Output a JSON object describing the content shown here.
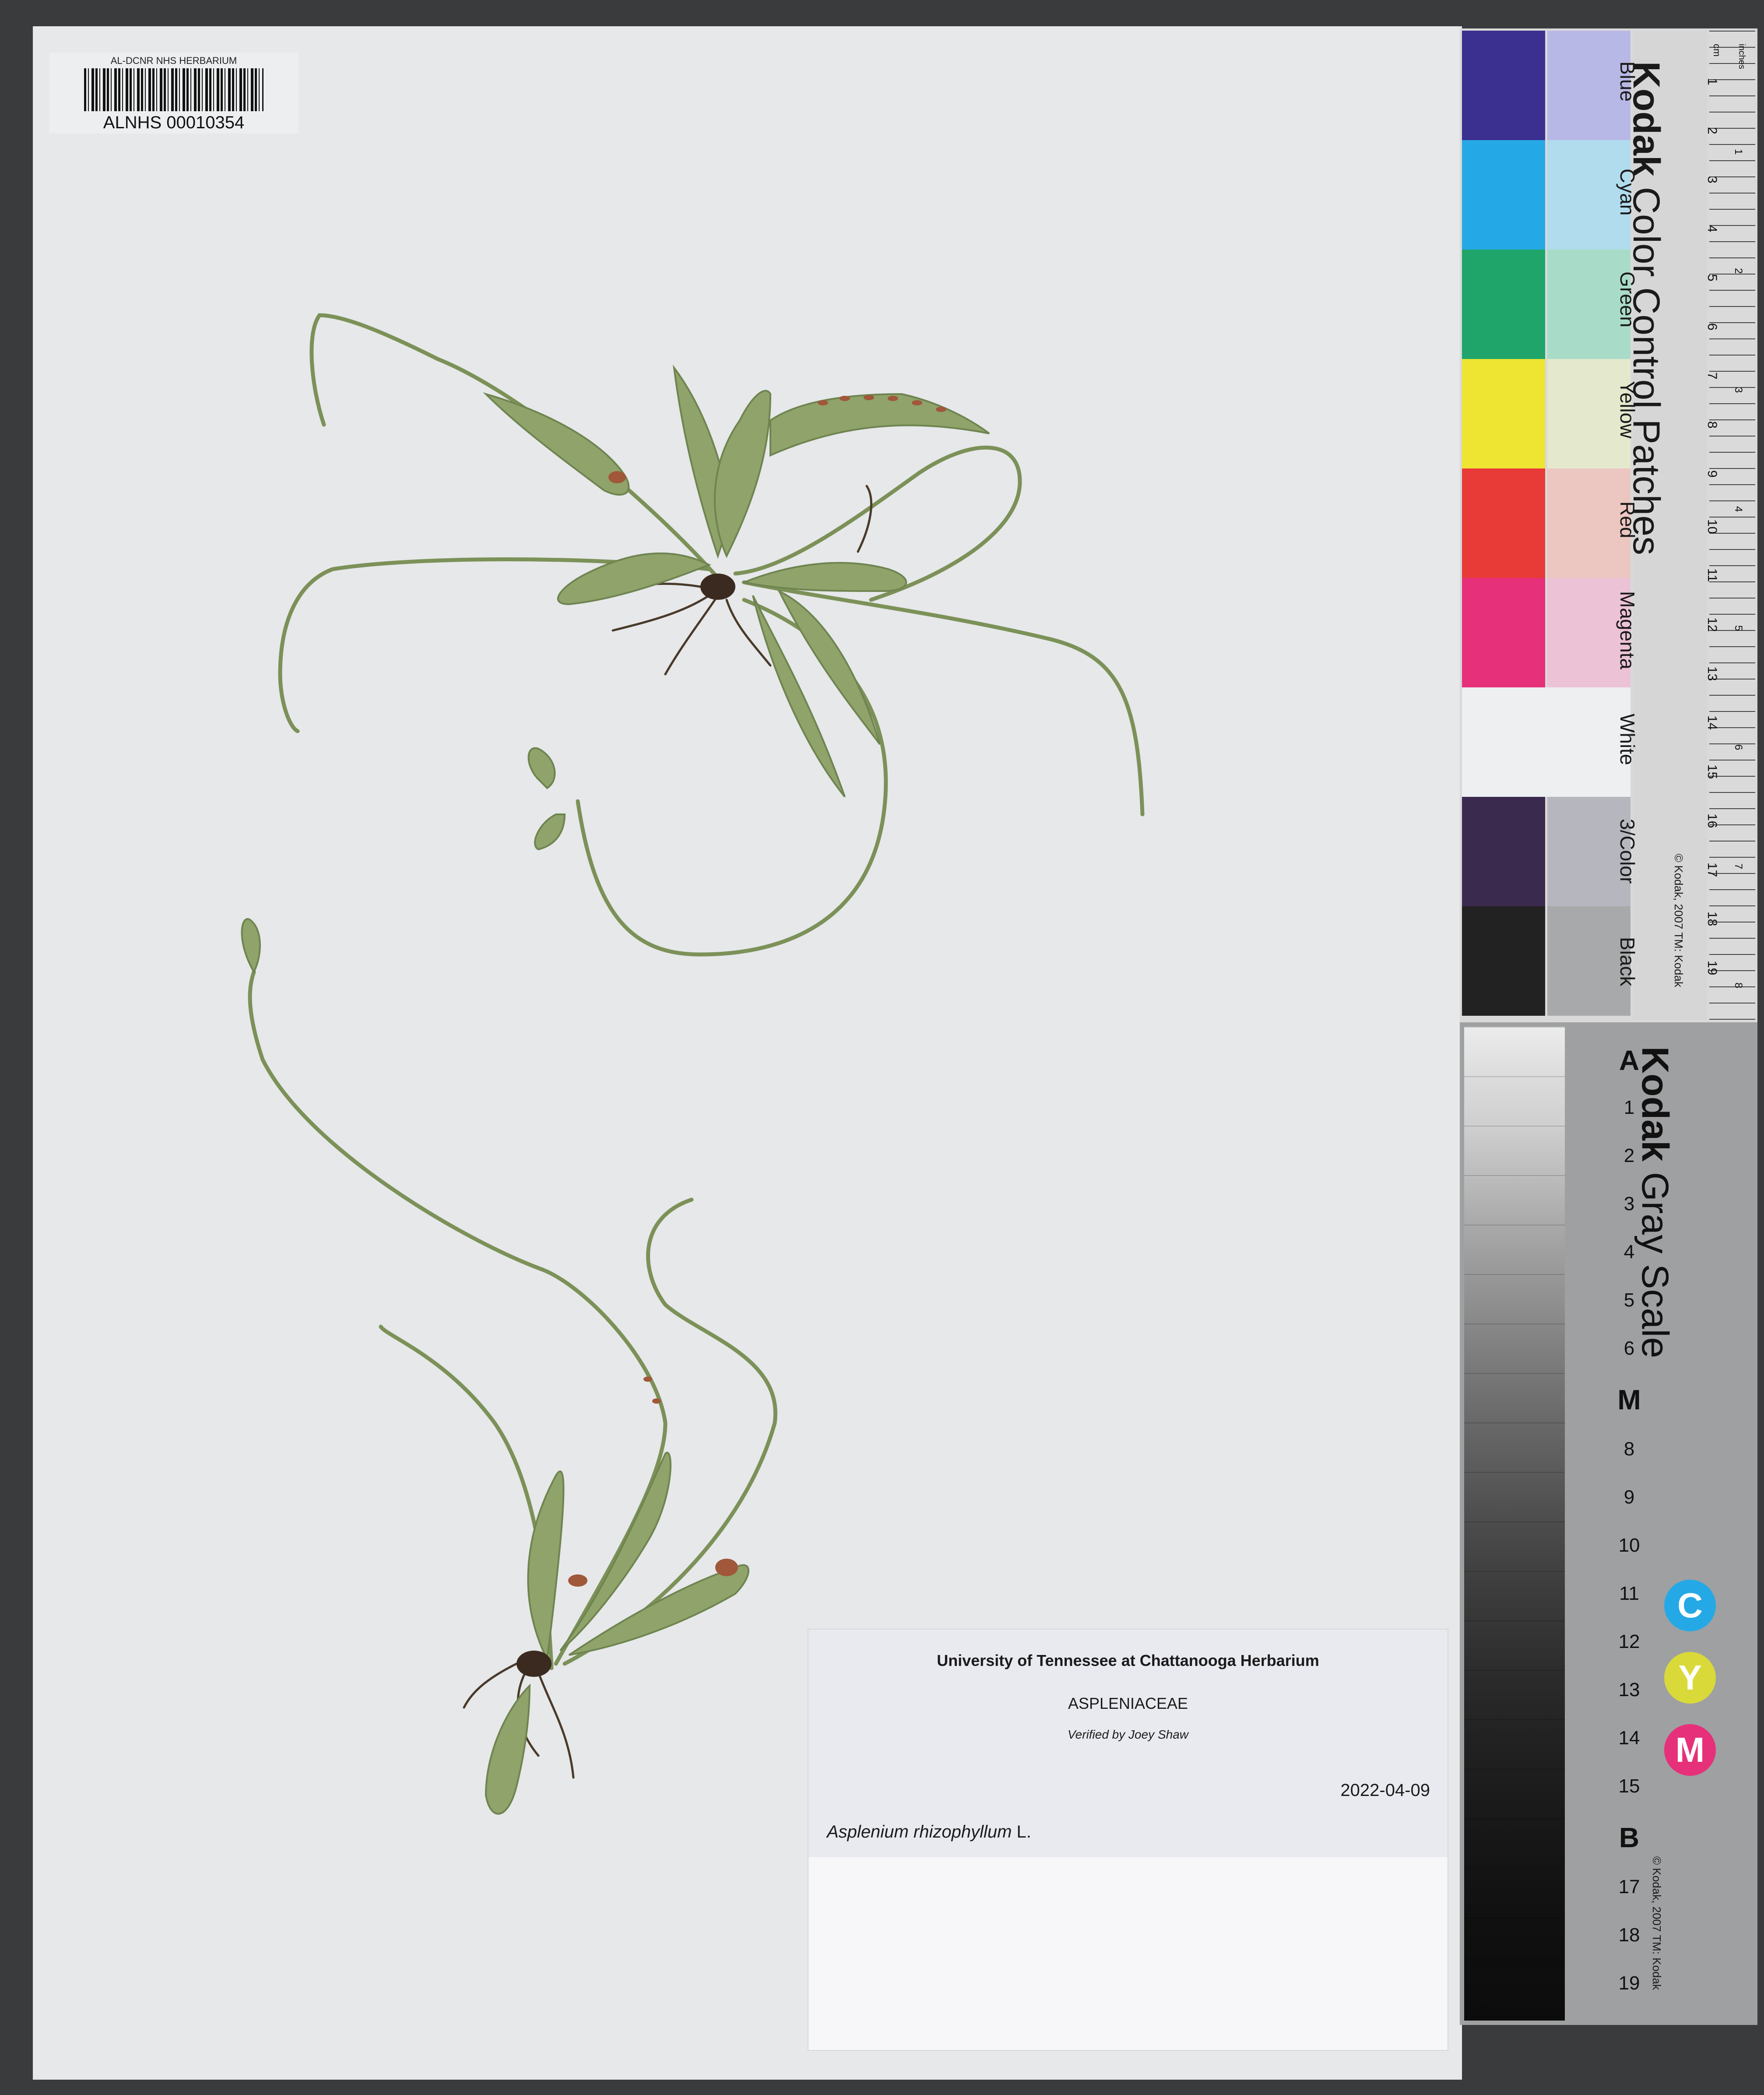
{
  "barcode": {
    "institution_line": "AL-DCNR NHS HERBARIUM",
    "number": "ALNHS 00010354"
  },
  "label": {
    "institution": "University of Tennessee at Chattanooga Herbarium",
    "family": "ASPLENIACEAE",
    "verified": "Verified by Joey Shaw",
    "date": "2022-04-09",
    "taxon_italic": "Asplenium rhizophyllum",
    "taxon_author": "L."
  },
  "color_card": {
    "brand": "Kodak",
    "title": "Color Control Patches",
    "patch_names": [
      "Blue",
      "Cyan",
      "Green",
      "Yellow",
      "Red",
      "Magenta",
      "White",
      "3/Color",
      "Black"
    ],
    "copyright": "© Kodak, 2007 TM: Kodak",
    "ruler_units": [
      "cm",
      "inches"
    ],
    "ruler_cm": [
      "1",
      "2",
      "3",
      "4",
      "5",
      "6",
      "7",
      "8",
      "9",
      "10",
      "11",
      "12",
      "13",
      "14",
      "15",
      "16",
      "17",
      "18",
      "19"
    ],
    "ruler_inch": [
      "1",
      "2",
      "3",
      "4",
      "5",
      "6",
      "7",
      "8"
    ]
  },
  "gray_card": {
    "brand": "Kodak",
    "title": "Gray Scale",
    "steps": [
      "A",
      "1",
      "2",
      "3",
      "4",
      "5",
      "6",
      "M",
      "8",
      "9",
      "10",
      "11",
      "12",
      "13",
      "14",
      "15",
      "B",
      "17",
      "18",
      "19"
    ],
    "dots": [
      "C",
      "Y",
      "M"
    ],
    "copyright": "© Kodak, 2007 TM: Kodak"
  },
  "colors": {
    "sheet": "#e6e8ea",
    "frond": "#8fa36a",
    "frond_dark": "#6f8450",
    "sorus": "#a0573a",
    "blue": "#3b2f8f",
    "cyan": "#25a9e6",
    "green": "#1fa56a",
    "yellow": "#eee533",
    "red": "#e83a37",
    "magenta": "#e7307a",
    "black": "#222222"
  }
}
